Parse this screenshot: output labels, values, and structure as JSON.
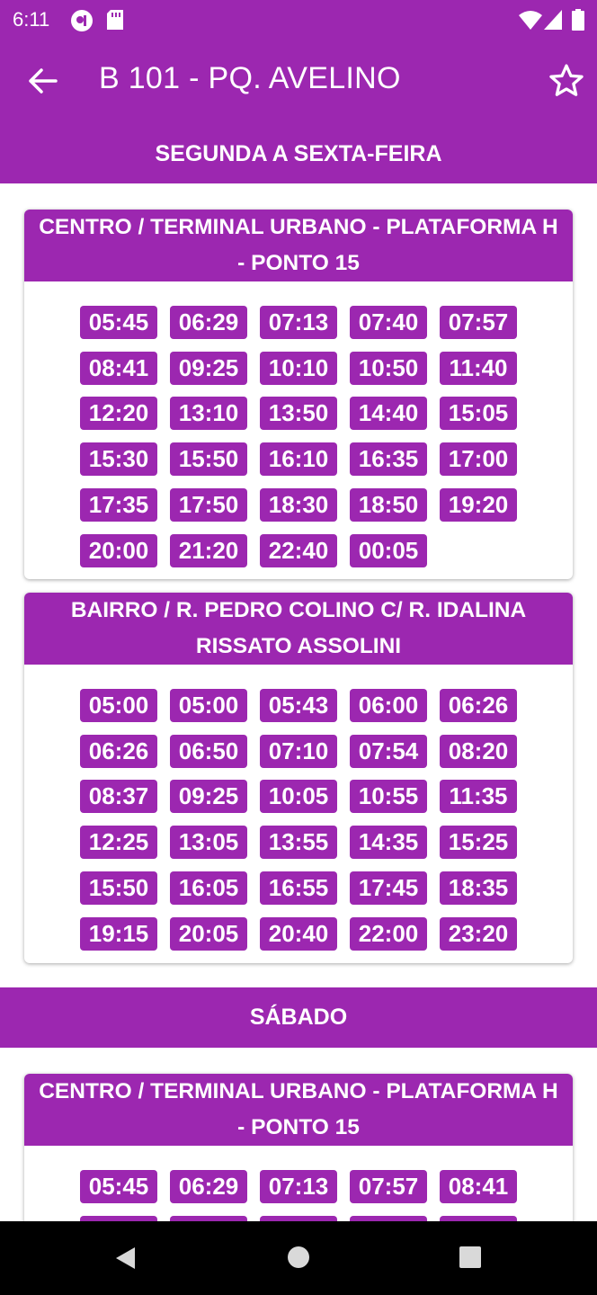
{
  "status_bar": {
    "time": "6:11"
  },
  "app_bar": {
    "title": "B 101 - PQ. AVELINO"
  },
  "schedules": [
    {
      "day": "SEGUNDA A SEXTA-FEIRA",
      "routes": [
        {
          "line1": "CENTRO / TERMINAL URBANO - PLATAFORMA H",
          "line2": "- PONTO 15",
          "times": [
            "05:45",
            "06:29",
            "07:13",
            "07:40",
            "07:57",
            "08:41",
            "09:25",
            "10:10",
            "10:50",
            "11:40",
            "12:20",
            "13:10",
            "13:50",
            "14:40",
            "15:05",
            "15:30",
            "15:50",
            "16:10",
            "16:35",
            "17:00",
            "17:35",
            "17:50",
            "18:30",
            "18:50",
            "19:20",
            "20:00",
            "21:20",
            "22:40",
            "00:05"
          ]
        },
        {
          "line1": "BAIRRO / R. PEDRO COLINO C/ R. IDALINA",
          "line2": "RISSATO ASSOLINI",
          "times": [
            "05:00",
            "05:00",
            "05:43",
            "06:00",
            "06:26",
            "06:26",
            "06:50",
            "07:10",
            "07:54",
            "08:20",
            "08:37",
            "09:25",
            "10:05",
            "10:55",
            "11:35",
            "12:25",
            "13:05",
            "13:55",
            "14:35",
            "15:25",
            "15:50",
            "16:05",
            "16:55",
            "17:45",
            "18:35",
            "19:15",
            "20:05",
            "20:40",
            "22:00",
            "23:20"
          ]
        }
      ]
    },
    {
      "day": "SÁBADO",
      "routes": [
        {
          "line1": "CENTRO / TERMINAL URBANO - PLATAFORMA H",
          "line2": "- PONTO 15",
          "times": [
            "05:45",
            "06:29",
            "07:13",
            "07:57",
            "08:41"
          ]
        }
      ]
    }
  ],
  "colors": {
    "primary": "#9c27b0",
    "nav_bar": "#000000"
  }
}
